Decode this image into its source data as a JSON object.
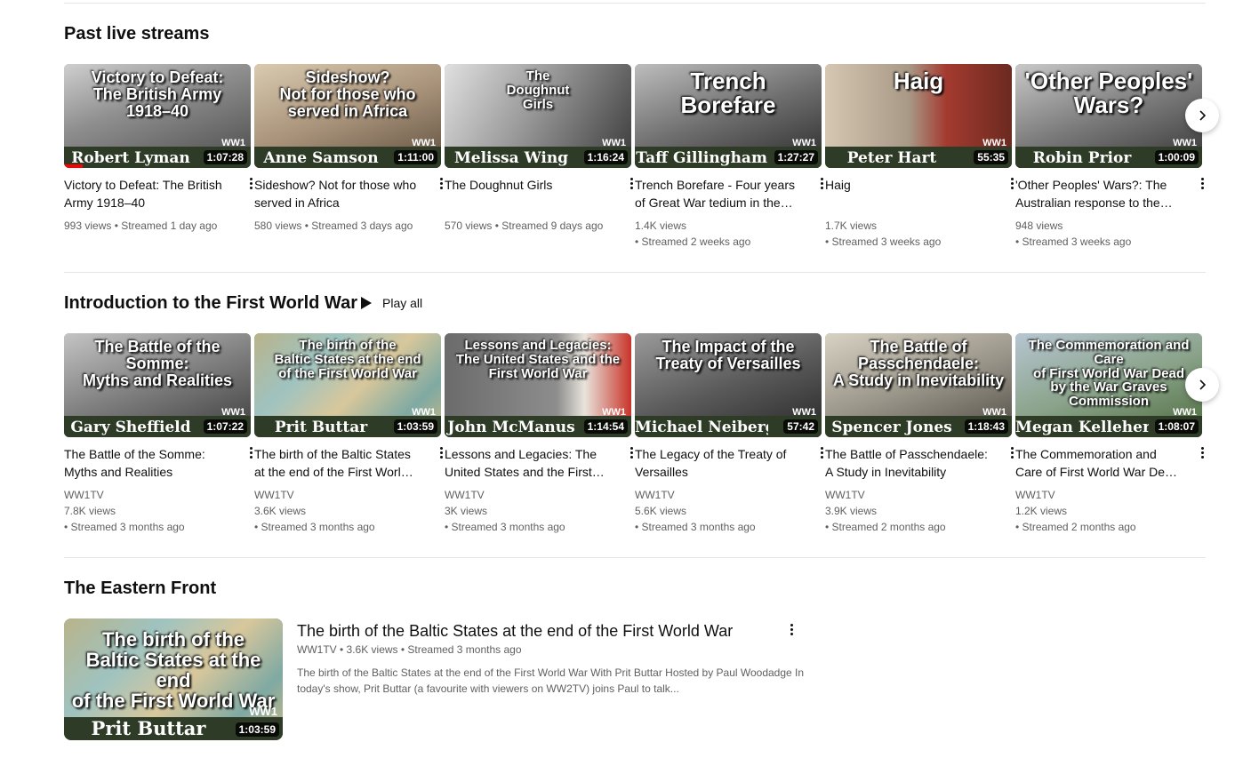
{
  "shelves": [
    {
      "title": "Past live streams",
      "cards": [
        {
          "thumb_title": "Victory to Defeat:\nThe British Army 1918–40",
          "speaker": "Robert Lyman",
          "duration": "1:07:28",
          "title": "Victory to Defeat: The British Army 1918–40",
          "meta1": "993 views • Streamed 1 day ago",
          "meta2": "",
          "progress": 0.1,
          "art": "a"
        },
        {
          "thumb_title": "Sideshow?\nNot for those who served in Africa",
          "speaker": "Anne Samson",
          "duration": "1:11:00",
          "title": "Sideshow? Not for those who served in Africa",
          "meta1": "580 views • Streamed 3 days ago",
          "meta2": "",
          "progress": 0,
          "art": "b"
        },
        {
          "thumb_title": "The\nDoughnut\nGirls",
          "speaker": "Melissa Wing",
          "duration": "1:16:24",
          "title": "The Doughnut Girls",
          "meta1": "570 views • Streamed 9 days ago",
          "meta2": "",
          "progress": 0,
          "art": "c"
        },
        {
          "thumb_title": "Trench Borefare",
          "speaker": "Taff Gillingham",
          "duration": "1:27:27",
          "title": "Trench Borefare - Four years of Great War tedium in the Front Line, with occasional bursts of action",
          "meta1": "1.4K views",
          "meta2": "• Streamed 2 weeks ago",
          "progress": 0,
          "art": "d"
        },
        {
          "thumb_title": "Haig",
          "speaker": "Peter Hart",
          "duration": "55:35",
          "title": "Haig",
          "meta1": "1.7K views",
          "meta2": "• Streamed 3 weeks ago",
          "progress": 0,
          "art": "e"
        },
        {
          "thumb_title": "'Other Peoples' Wars?",
          "speaker": "Robin Prior",
          "duration": "1:00:09",
          "title": "'Other Peoples' Wars?: The Australian response to the two World Wars",
          "meta1": "948 views",
          "meta2": "• Streamed 3 weeks ago",
          "progress": 0,
          "art": "f"
        }
      ]
    },
    {
      "title": "Introduction to the First World War",
      "play_all": "Play all",
      "cards": [
        {
          "thumb_title": "The Battle of the Somme:\nMyths and Realities",
          "speaker": "Gary Sheffield",
          "duration": "1:07:22",
          "title": "The Battle of the Somme: Myths and Realities",
          "channel": "WW1TV",
          "meta1": "7.8K views",
          "meta2": "• Streamed 3 months ago",
          "art": "g"
        },
        {
          "thumb_title": "The birth of the\nBaltic States at the end\nof the First World War",
          "speaker": "Prit Buttar",
          "duration": "1:03:59",
          "title": "The birth of the Baltic States at the end of the First World War",
          "channel": "WW1TV",
          "meta1": "3.6K views",
          "meta2": "• Streamed 3 months ago",
          "art": "h"
        },
        {
          "thumb_title": "Lessons and Legacies:\nThe United States and the\nFirst World War",
          "speaker": "John McManus",
          "duration": "1:14:54",
          "title": "Lessons and Legacies: The United States and the First World War",
          "channel": "WW1TV",
          "meta1": "3K views",
          "meta2": "• Streamed 3 months ago",
          "art": "i"
        },
        {
          "thumb_title": "The Impact of the\nTreaty of Versailles",
          "speaker": "Michael Neiberg",
          "duration": "57:42",
          "title": "The Legacy of the Treaty of Versailles",
          "channel": "WW1TV",
          "meta1": "5.6K views",
          "meta2": "• Streamed 3 months ago",
          "art": "j"
        },
        {
          "thumb_title": "The Battle of Passchendaele:\nA Study in Inevitability",
          "speaker": "Spencer Jones",
          "duration": "1:18:43",
          "title": "The Battle of Passchendaele: A Study in Inevitability",
          "channel": "WW1TV",
          "meta1": "3.9K views",
          "meta2": "• Streamed 2 months ago",
          "art": "k"
        },
        {
          "thumb_title": "The Commemoration and Care\nof First World War Dead\nby the War Graves Commission",
          "speaker": "Megan Kelleher",
          "duration": "1:08:07",
          "title": "The Commemoration and Care of First World War Dead by the War Graves Commission",
          "channel": "WW1TV",
          "meta1": "1.2K views",
          "meta2": "• Streamed 2 months ago",
          "art": "l"
        }
      ]
    }
  ],
  "eastern": {
    "title": "The Eastern Front",
    "video": {
      "thumb_title": "The birth of the\nBaltic States at the end\nof the First World War",
      "speaker": "Prit Buttar",
      "duration": "1:03:59",
      "title": "The birth of the Baltic States at the end of the First World War",
      "meta": "WW1TV • 3.6K views • Streamed 3 months ago",
      "description": "The birth of the Baltic States at the end of the First World War With Prit Buttar Hosted by Paul Woodadge In today's show, Prit Buttar (a favourite with viewers on WW2TV) joins Paul to talk..."
    }
  },
  "badge": "WW1",
  "icons": {
    "next": "chevron-right-icon",
    "menu": "more-vert-icon",
    "play": "play-icon"
  }
}
